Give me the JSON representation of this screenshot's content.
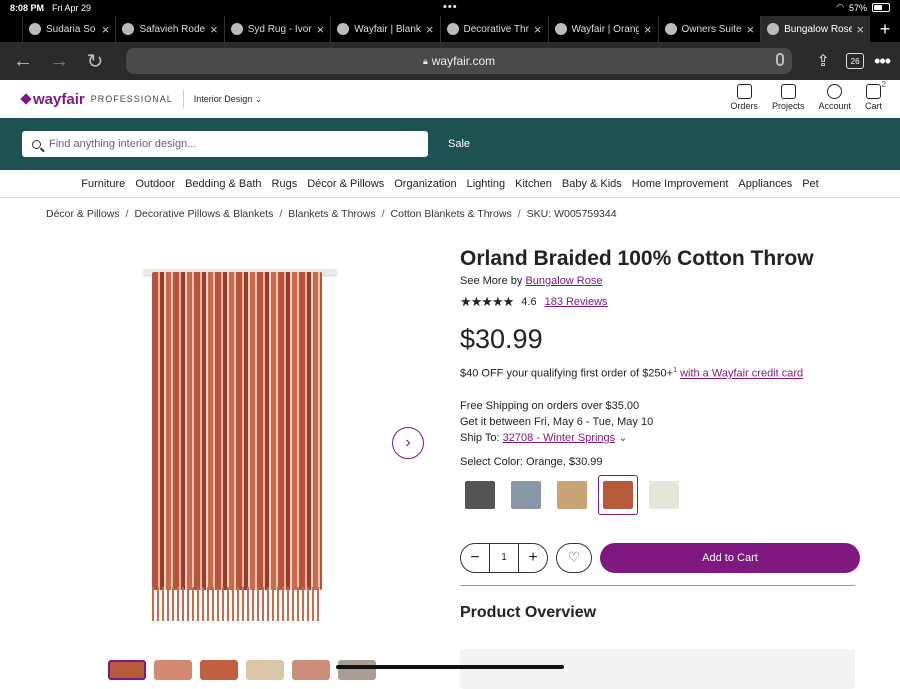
{
  "status": {
    "time": "8:08 PM",
    "date": "Fri Apr 29",
    "dots": "•••",
    "battery": "57%",
    "battery_level": 0.57
  },
  "tabs": [
    {
      "title": "Sudaria So",
      "active": false
    },
    {
      "title": "Safavieh Rode",
      "active": false
    },
    {
      "title": "Syd Rug - Ivor",
      "active": false
    },
    {
      "title": "Wayfair | Blank",
      "active": false
    },
    {
      "title": "Decorative Thr",
      "active": false
    },
    {
      "title": "Wayfair | Orang",
      "active": false
    },
    {
      "title": "Owners Suite",
      "active": false
    },
    {
      "title": "Bungalow Rose",
      "active": true
    }
  ],
  "toolbar": {
    "url": "wayfair.com",
    "tab_count": "26"
  },
  "header": {
    "logo": "wayfair",
    "logo_pro": "PROFESSIONAL",
    "industry": "Interior Design",
    "icons": [
      {
        "label": "Orders",
        "icon": "box-icon"
      },
      {
        "label": "Projects",
        "icon": "projects-icon"
      },
      {
        "label": "Account",
        "icon": "account-icon"
      },
      {
        "label": "Cart",
        "icon": "cart-icon",
        "count": "2"
      }
    ]
  },
  "search": {
    "placeholder": "Find anything interior design...",
    "sale": "Sale"
  },
  "categories": [
    "Furniture",
    "Outdoor",
    "Bedding & Bath",
    "Rugs",
    "Décor & Pillows",
    "Organization",
    "Lighting",
    "Kitchen",
    "Baby & Kids",
    "Home Improvement",
    "Appliances",
    "Pet"
  ],
  "breadcrumb": [
    "Décor & Pillows",
    "Decorative Pillows & Blankets",
    "Blankets & Throws",
    "Cotton Blankets & Throws",
    "SKU: W005759344"
  ],
  "product": {
    "title": "Orland Braided 100% Cotton Throw",
    "see_more": "See More by",
    "brand": "Bungalow Rose",
    "rating": "4.6",
    "stars": "★★★★★",
    "reviews": "183 Reviews",
    "price": "$30.99",
    "promo": "$40 OFF your qualifying first order of $250+",
    "promo_sup": "1",
    "promo_link": "with a Wayfair credit card",
    "shipping": "Free Shipping on orders over $35.00",
    "delivery": "Get it between Fri, May 6 - Tue, May 10",
    "ship_to_label": "Ship To:",
    "ship_to": "32708 - Winter Springs",
    "color_label": "Select Color: Orange, $30.99",
    "swatches": [
      {
        "color": "#555555",
        "selected": false
      },
      {
        "color": "#8a97a6",
        "selected": false
      },
      {
        "color": "#c8a475",
        "selected": false
      },
      {
        "color": "#b65a3c",
        "selected": true
      },
      {
        "color": "#e6e6d8",
        "selected": false
      }
    ],
    "quantity": "1",
    "add_to_cart": "Add to Cart",
    "overview": "Product Overview"
  },
  "colors": {
    "brand": "#7f187f",
    "band": "#1d5152"
  }
}
